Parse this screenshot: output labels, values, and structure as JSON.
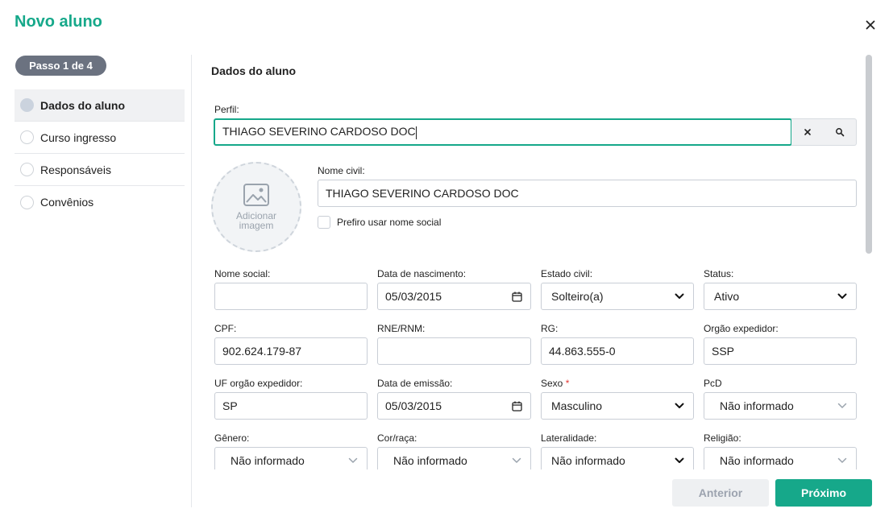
{
  "header": {
    "title": "Novo aluno",
    "close_icon": "close-icon"
  },
  "stepper": {
    "pill": "Passo 1 de 4",
    "items": [
      {
        "label": "Dados do aluno",
        "active": true
      },
      {
        "label": "Curso ingresso",
        "active": false
      },
      {
        "label": "Responsáveis",
        "active": false
      },
      {
        "label": "Convênios",
        "active": false
      }
    ]
  },
  "form": {
    "section_title": "Dados do aluno",
    "perfil": {
      "label": "Perfil:",
      "value": "THIAGO SEVERINO CARDOSO DOC"
    },
    "avatar": {
      "caption": "Adicionar imagem",
      "icon": "image-icon"
    },
    "nome_civil": {
      "label": "Nome civil:",
      "value": "THIAGO SEVERINO CARDOSO DOC"
    },
    "nome_social_checkbox": {
      "label": "Prefiro usar nome social",
      "checked": false
    },
    "nome_social": {
      "label": "Nome social:",
      "value": ""
    },
    "data_nascimento": {
      "label": "Data de nascimento:",
      "value": "05/03/2015"
    },
    "estado_civil": {
      "label": "Estado civil:",
      "value": "Solteiro(a)"
    },
    "status": {
      "label": "Status:",
      "value": "Ativo"
    },
    "cpf": {
      "label": "CPF:",
      "value": "902.624.179-87"
    },
    "rne": {
      "label": "RNE/RNM:",
      "value": ""
    },
    "rg": {
      "label": "RG:",
      "value": "44.863.555-0"
    },
    "orgao_expedidor": {
      "label": "Orgão expedidor:",
      "value": "SSP"
    },
    "uf_orgao": {
      "label": "UF orgão expedidor:",
      "value": "SP"
    },
    "data_emissao": {
      "label": "Data de emissão:",
      "value": "05/03/2015"
    },
    "sexo": {
      "label": "Sexo",
      "required_mark": "*",
      "value": "Masculino"
    },
    "pcd": {
      "label": "PcD",
      "value": "Não informado"
    },
    "genero": {
      "label": "Gênero:",
      "value": "Não informado"
    },
    "cor_raca": {
      "label": "Cor/raça:",
      "value": "Não informado"
    },
    "lateralidade": {
      "label": "Lateralidade:",
      "value": "Não informado"
    },
    "religiao": {
      "label": "Religião:",
      "value": "Não informado"
    }
  },
  "footer": {
    "prev_label": "Anterior",
    "next_label": "Próximo"
  },
  "colors": {
    "accent": "#16a88a",
    "pill": "#6b7280",
    "required": "#e53935"
  }
}
